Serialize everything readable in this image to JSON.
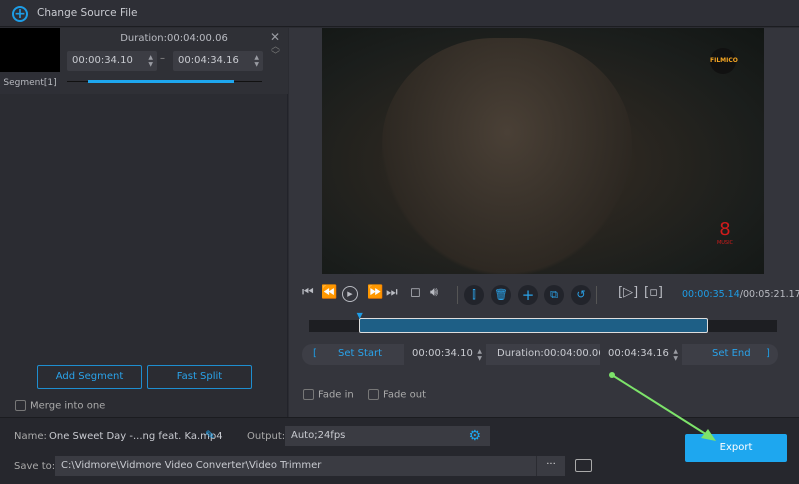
{
  "topbar": {
    "change_source": "Change Source File",
    "icon": "plus-circle-icon"
  },
  "segment": {
    "label": "Segment[1]",
    "duration": "Duration:00:04:00.06",
    "start": "00:00:34.10",
    "end": "00:04:34.16",
    "dash": "–"
  },
  "left": {
    "add_segment": "Add Segment",
    "fast_split": "Fast Split",
    "merge": "Merge into one"
  },
  "video": {
    "watermark_top": "FILMICO",
    "watermark_bottom": "MUSIC"
  },
  "player": {
    "current_time": "00:00:35.14",
    "total_time": "/00:05:21.17",
    "progress": 0.11
  },
  "trim": {
    "set_start": "Set Start",
    "start": "00:00:34.10",
    "duration": "Duration:00:04:00.06",
    "end": "00:04:34.16",
    "set_end": "Set End",
    "bracket_open": "[",
    "bracket_close": "]",
    "selection_start": 0.106,
    "selection_end": 0.853
  },
  "fade": {
    "fade_in": "Fade in",
    "fade_out": "Fade out"
  },
  "bottom": {
    "name_label": "Name:",
    "name_value": "One Sweet Day -...ng feat. Ka.mp4",
    "output_label": "Output:",
    "output_value": "Auto;24fps",
    "save_label": "Save to:",
    "save_path": "C:\\Vidmore\\Vidmore Video Converter\\Video Trimmer",
    "more": "···",
    "export": "Export"
  },
  "colors": {
    "accent": "#1e9de6",
    "export": "#1ea7ef",
    "annotation_arrow": "#7de36a"
  }
}
